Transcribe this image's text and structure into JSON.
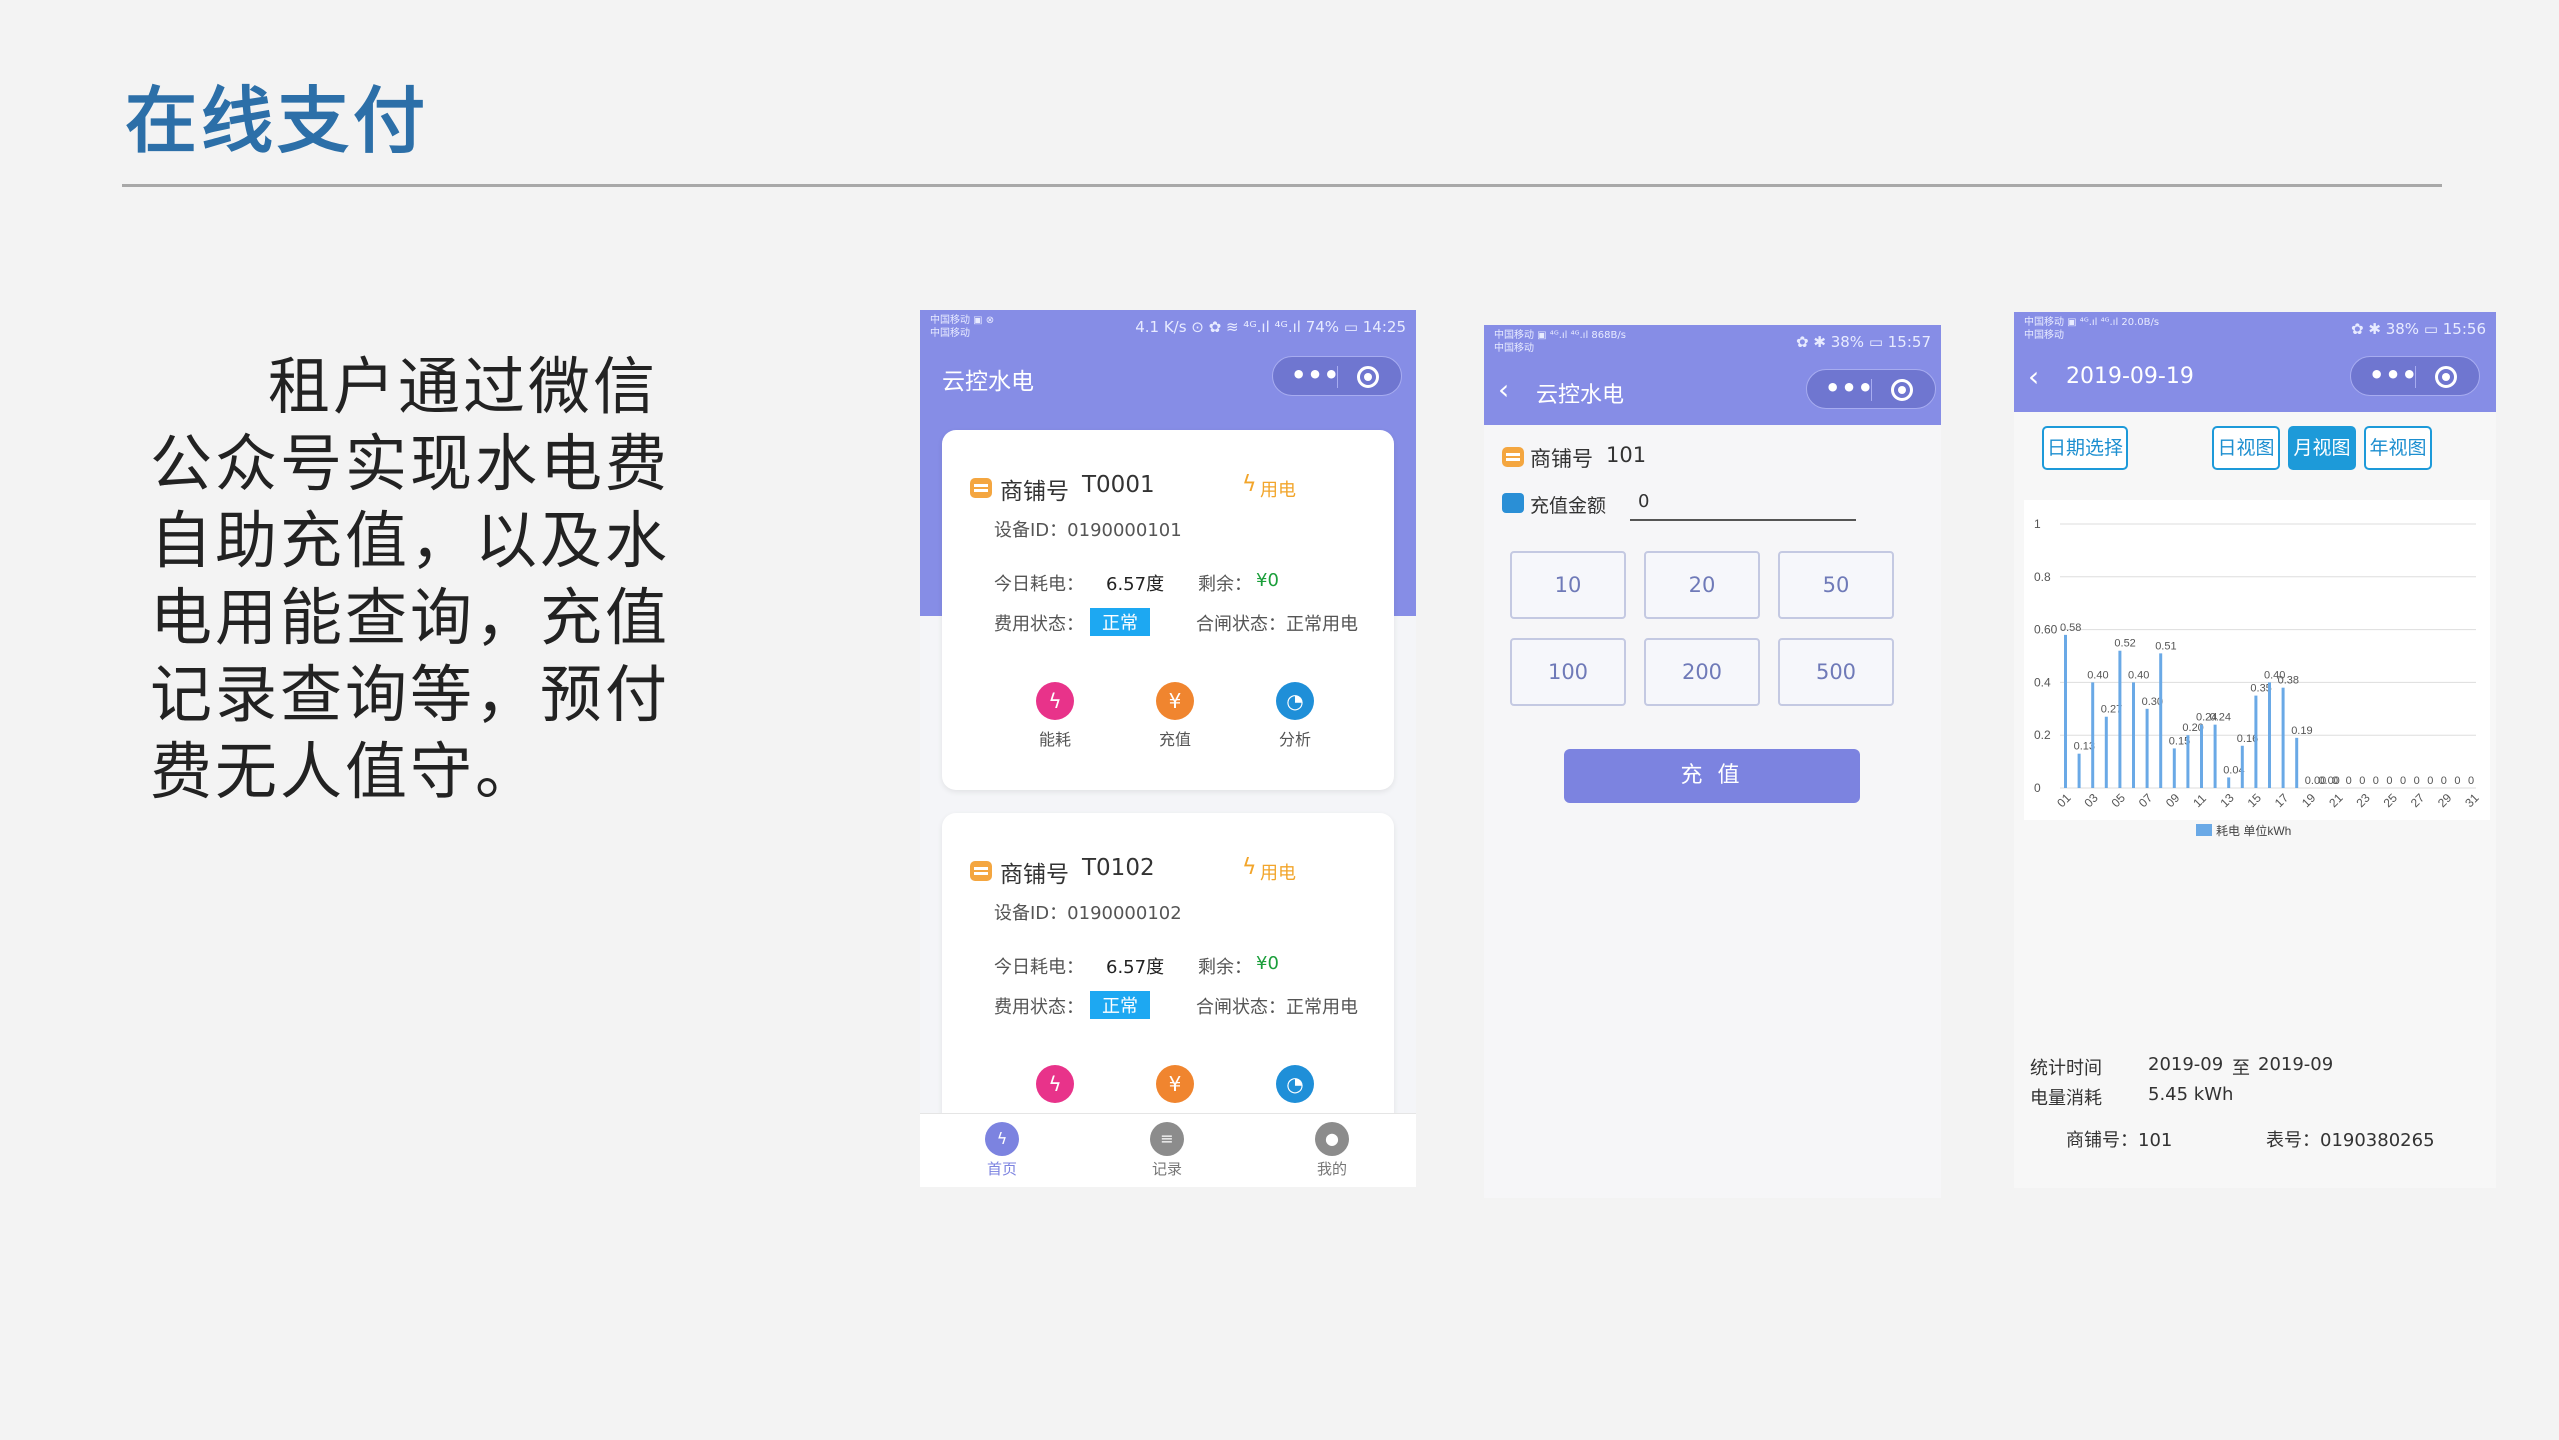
{
  "slide": {
    "title": "在线支付",
    "body": "租户通过微信公众号实现水电费自助充值，以及水电用能查询，充值记录查询等，预付费无人值守。"
  },
  "phone1": {
    "status_left_1": "中国移动 ▣ ⊗",
    "status_left_2": "中国移动",
    "status_right": "4.1 K/s ⊙ ✿ ≋ ⁴ᴳ.ıl ⁴ᴳ.ıl 74% ▭ 14:25",
    "app_title": "云控水电",
    "capsule_dots": "•••",
    "cards": [
      {
        "shop_label": "商铺号",
        "shop_no": "T0001",
        "type_label": "用电",
        "device": "设备ID：0190000101",
        "usage_label": "今日耗电：",
        "usage_value": "6.57度",
        "balance_label": "剩余：",
        "balance_value": "¥0",
        "fee_label": "费用状态：",
        "fee_value": "正常",
        "switch_label": "合闸状态：正常用电",
        "actions": [
          "能耗",
          "充值",
          "分析"
        ]
      },
      {
        "shop_label": "商铺号",
        "shop_no": "T0102",
        "type_label": "用电",
        "device": "设备ID：0190000102",
        "usage_label": "今日耗电：",
        "usage_value": "6.57度",
        "balance_label": "剩余：",
        "balance_value": "¥0",
        "fee_label": "费用状态：",
        "fee_value": "正常",
        "switch_label": "合闸状态：正常用电"
      }
    ],
    "tabs": [
      "首页",
      "记录",
      "我的"
    ],
    "colors": {
      "header": "#868de6",
      "pink": "#e8338a",
      "orange": "#f0852f",
      "blue": "#1f8fd8"
    }
  },
  "phone2": {
    "status_left_1": "中国移动 ▣ ⁴ᴳ.ıl ⁴ᴳ.ıl 868B/s",
    "status_left_2": "中国移动",
    "status_right": "✿ ✱ 38% ▭ 15:57",
    "app_title": "云控水电",
    "shop_label": "商铺号",
    "shop_no": "101",
    "amount_label": "充值金额",
    "amount_value": "0",
    "amounts": [
      "10",
      "20",
      "50",
      "100",
      "200",
      "500"
    ],
    "submit": "充 值"
  },
  "phone3": {
    "status_left_1": "中国移动 ▣ ⁴ᴳ.ıl ⁴ᴳ.ıl 20.0B/s",
    "status_left_2": "中国移动",
    "status_right": "✿ ✱ 38% ▭ 15:56",
    "date_title": "2019-09-19",
    "date_select": "日期选择",
    "views": [
      "日视图",
      "月视图",
      "年视图"
    ],
    "active_view": "月视图",
    "stat_time_label": "统计时间",
    "stat_from": "2019-09",
    "stat_to_word": "至",
    "stat_to": "2019-09",
    "consumption_label": "电量消耗",
    "consumption_value": "5.45 kWh",
    "shop_label": "商铺号：101",
    "meter_label": "表号：0190380265"
  },
  "chart_data": {
    "type": "bar",
    "categories": [
      "01",
      "02",
      "03",
      "04",
      "05",
      "06",
      "07",
      "08",
      "09",
      "10",
      "11",
      "12",
      "13",
      "14",
      "15",
      "16",
      "17",
      "18",
      "19",
      "20",
      "21",
      "22",
      "23",
      "24",
      "25",
      "26",
      "27",
      "28",
      "29",
      "30",
      "31"
    ],
    "x_tick_labels": [
      "01",
      "03",
      "05",
      "07",
      "09",
      "11",
      "13",
      "15",
      "17",
      "19",
      "21",
      "23",
      "25",
      "27",
      "29",
      "31"
    ],
    "series": [
      {
        "name": "耗电 单位kWh",
        "values": [
          0.58,
          0.13,
          0.4,
          0.27,
          0.52,
          0.4,
          0.3,
          0.51,
          0.15,
          0.2,
          0.24,
          0.24,
          0.04,
          0.16,
          0.35,
          0.4,
          0.38,
          0.19,
          0,
          0,
          0,
          0,
          0,
          0,
          0,
          0,
          0,
          0,
          0,
          0,
          0
        ],
        "color": "#6aa9e6"
      }
    ],
    "data_labels": [
      "0.58",
      "0.13",
      "0.40",
      "0.27",
      "0.52",
      "0.40",
      "0.30",
      "0.51",
      "0.15",
      "0.20",
      "0.24",
      "0.24",
      "0.04",
      "0.16",
      "0.35",
      "0.40",
      "0.38",
      "0.19",
      "0.00",
      "0.00",
      "0",
      "0",
      "0",
      "0",
      "0",
      "0",
      "0",
      "0",
      "0",
      "0",
      "0"
    ],
    "y_ticks": [
      "0",
      "0.2",
      "0.4",
      "0.60",
      "0.8",
      "1"
    ],
    "ylim": [
      0,
      1
    ],
    "grid": true,
    "legend_position": "bottom"
  }
}
